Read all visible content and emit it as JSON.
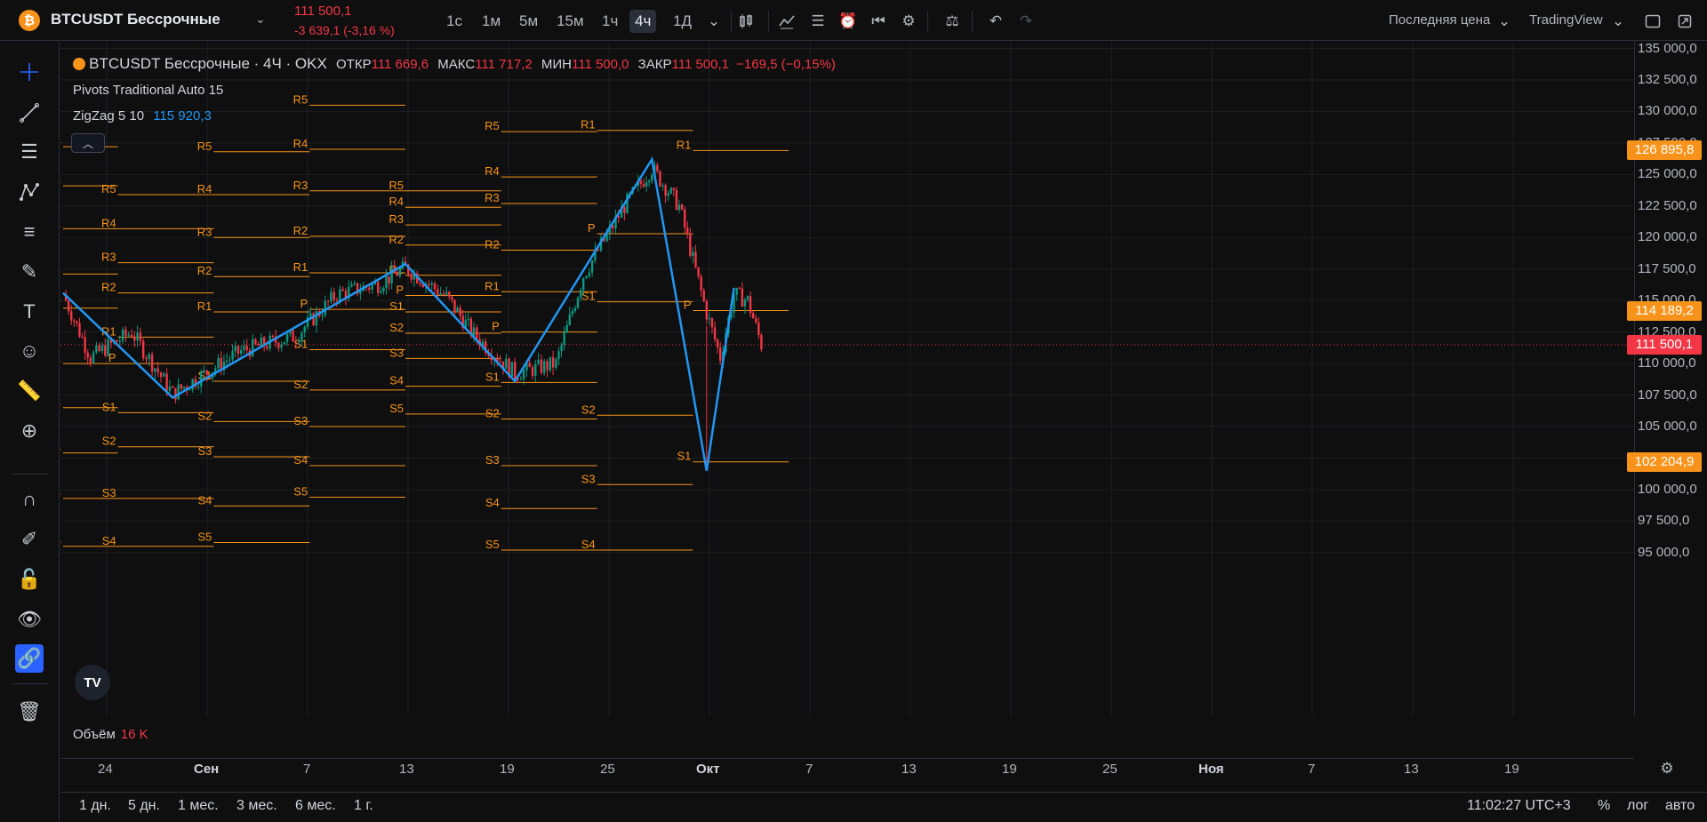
{
  "header": {
    "symbol": "BTCUSDT Бессрочные",
    "logo": "bitcoin-logo",
    "price": "111 500,1",
    "change": "-3 639,1 (-3,16 %)",
    "timeframes": [
      "1с",
      "1м",
      "5м",
      "15м",
      "1ч",
      "4ч",
      "1Д"
    ],
    "active_timeframe": "4ч",
    "price_type": "Последняя цена",
    "broker": "TradingView"
  },
  "legend": {
    "title": "BTCUSDT Бессрочные · 4Ч · OKX",
    "open_label": "ОТКР",
    "open": "111 669,6",
    "high_label": "МАКС",
    "high": "111 717,2",
    "low_label": "МИН",
    "low": "111 500,0",
    "close_label": "ЗАКР",
    "close": "111 500,1",
    "change": "−169,5 (−0,15%)",
    "pivots": "Pivots Traditional Auto 15",
    "zigzag": "ZigZag 5 10",
    "zigzag_value": "115 920,3"
  },
  "price_axis": [
    "135 000,0",
    "132 500,0",
    "130 000,0",
    "127 500,0",
    "125 000,0",
    "122 500,0",
    "120 000,0",
    "117 500,0",
    "115 000,0",
    "112 500,0",
    "110 000,0",
    "107 500,0",
    "105 000,0",
    "102 500,0",
    "100 000,0",
    "97 500,0",
    "95 000,0"
  ],
  "price_tags": [
    {
      "label": "126 895,8",
      "color": "#f7931a",
      "value": 126895.8
    },
    {
      "label": "114 189,2",
      "color": "#f7931a",
      "value": 114189.2
    },
    {
      "label": "111 500,1",
      "color": "#f23645",
      "value": 111500.1
    },
    {
      "label": "102 204,9",
      "color": "#f7931a",
      "value": 102204.9
    }
  ],
  "time_axis": [
    {
      "label": "24",
      "bold": false
    },
    {
      "label": "Сен",
      "bold": true
    },
    {
      "label": "7",
      "bold": false
    },
    {
      "label": "13",
      "bold": false
    },
    {
      "label": "19",
      "bold": false
    },
    {
      "label": "25",
      "bold": false
    },
    {
      "label": "Окт",
      "bold": true
    },
    {
      "label": "7",
      "bold": false
    },
    {
      "label": "13",
      "bold": false
    },
    {
      "label": "19",
      "bold": false
    },
    {
      "label": "25",
      "bold": false
    },
    {
      "label": "Ноя",
      "bold": true
    },
    {
      "label": "7",
      "bold": false
    },
    {
      "label": "13",
      "bold": false
    },
    {
      "label": "19",
      "bold": false
    }
  ],
  "volume": {
    "label": "Объём",
    "value": "16 K"
  },
  "ranges": [
    "1 дн.",
    "5 дн.",
    "1 мес.",
    "3 мес.",
    "6 мес.",
    "1 г."
  ],
  "footer": {
    "time": "11:02:27 UTC+3",
    "percent": "%",
    "log": "лог",
    "auto": "авто"
  },
  "colors": {
    "pivot": "#f7931a",
    "zigzag": "#2196f3",
    "up": "#089981",
    "down": "#f23645",
    "active": "#2962ff"
  },
  "chart_data": {
    "type": "candlestick",
    "title": "BTCUSDT Бессрочные · 4Ч · OKX",
    "ylim": [
      93000,
      136000
    ],
    "zigzag": [
      {
        "x": "2025-08-24",
        "y": 115600
      },
      {
        "x": "2025-09-01",
        "y": 107300
      },
      {
        "x": "2025-09-18",
        "y": 117900
      },
      {
        "x": "2025-09-26",
        "y": 108600
      },
      {
        "x": "2025-10-06",
        "y": 126200
      },
      {
        "x": "2025-10-10",
        "y": 101500
      },
      {
        "x": "2025-10-12",
        "y": 116000
      }
    ],
    "close_path": [
      {
        "x": "2025-08-24",
        "y": 115500
      },
      {
        "x": "2025-08-26",
        "y": 110500
      },
      {
        "x": "2025-08-29",
        "y": 112500
      },
      {
        "x": "2025-09-01",
        "y": 107600
      },
      {
        "x": "2025-09-06",
        "y": 111000
      },
      {
        "x": "2025-09-10",
        "y": 112200
      },
      {
        "x": "2025-09-13",
        "y": 115500
      },
      {
        "x": "2025-09-16",
        "y": 116300
      },
      {
        "x": "2025-09-18",
        "y": 117600
      },
      {
        "x": "2025-09-21",
        "y": 115300
      },
      {
        "x": "2025-09-23",
        "y": 112300
      },
      {
        "x": "2025-09-26",
        "y": 109200
      },
      {
        "x": "2025-09-29",
        "y": 110000
      },
      {
        "x": "2025-10-01",
        "y": 117000
      },
      {
        "x": "2025-10-04",
        "y": 122500
      },
      {
        "x": "2025-10-06",
        "y": 125500
      },
      {
        "x": "2025-10-08",
        "y": 122500
      },
      {
        "x": "2025-10-10",
        "y": 114000
      },
      {
        "x": "2025-10-11",
        "y": 110500
      },
      {
        "x": "2025-10-12",
        "y": 115500
      },
      {
        "x": "2025-10-13",
        "y": 115000
      },
      {
        "x": "2025-10-14",
        "y": 111500
      }
    ],
    "pivot_levels": [
      {
        "period_start": "2025-08-24",
        "period_end": "2025-08-28",
        "levels": {
          "R4": 127200,
          "R3": 124100,
          "R2": 120700,
          "R1": 117100,
          "P": 114400,
          "S1": 110000,
          "S2": 106500,
          "S3": 102900,
          "S4": 99300,
          "S5": 95500
        }
      },
      {
        "period_start": "2025-08-28",
        "period_end": "2025-09-04",
        "levels": {
          "R5": 123400,
          "R4": 120700,
          "R3": 118000,
          "R2": 115600,
          "R1": 112100,
          "P": 110000,
          "S1": 106100,
          "S2": 103400,
          "S3": 99300,
          "S4": 95500
        }
      },
      {
        "period_start": "2025-09-04",
        "period_end": "2025-09-11",
        "levels": {
          "R5": 126800,
          "R4": 123400,
          "R3": 120000,
          "R2": 116900,
          "R1": 114100,
          "S1": 108600,
          "S2": 105400,
          "S3": 102600,
          "S4": 98700,
          "S5": 95800
        }
      },
      {
        "period_start": "2025-09-11",
        "period_end": "2025-09-18",
        "levels": {
          "R5": 130500,
          "R4": 127000,
          "R3": 123700,
          "R2": 120100,
          "R1": 117200,
          "P": 114300,
          "S1": 111100,
          "S2": 107900,
          "S3": 105000,
          "S4": 101900,
          "S5": 99400
        }
      },
      {
        "period_start": "2025-09-18",
        "period_end": "2025-09-25",
        "levels": {
          "R5": 123700,
          "R4": 122400,
          "R3": 121000,
          "R2": 119400,
          "R1": 117000,
          "P": 115400,
          "S1": 114100,
          "S2": 112400,
          "S3": 110400,
          "S4": 108200,
          "S5": 106000
        }
      },
      {
        "period_start": "2025-09-25",
        "period_end": "2025-10-02",
        "levels": {
          "R5": 128400,
          "R4": 124800,
          "R3": 122700,
          "R2": 119000,
          "R1": 115700,
          "P": 112500,
          "S1": 108500,
          "S2": 105600,
          "S3": 101900,
          "S4": 98500,
          "S5": 95200
        }
      },
      {
        "period_start": "2025-10-02",
        "period_end": "2025-10-09",
        "levels": {
          "R1": 128500,
          "P": 120300,
          "S1": 114900,
          "S2": 105900,
          "S3": 100400,
          "S4": 95200
        }
      },
      {
        "period_start": "2025-10-09",
        "period_end": "2025-10-16",
        "levels": {
          "R1": 126900,
          "P": 114200,
          "S1": 102200
        }
      }
    ]
  }
}
